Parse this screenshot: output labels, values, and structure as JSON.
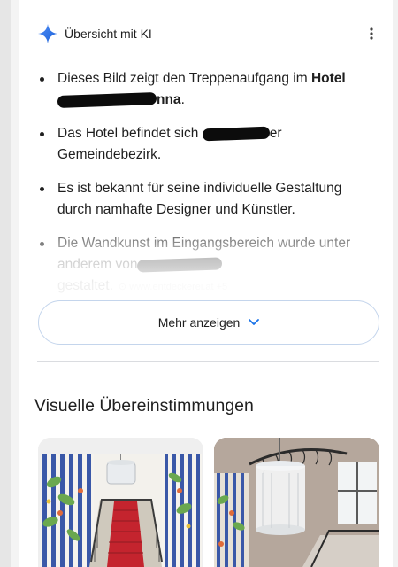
{
  "ai_overview": {
    "title": "Übersicht mit KI",
    "bullets": [
      {
        "before": "Dieses Bild zeigt den Treppenaufgang im ",
        "bold": "Hotel",
        "bold_tail": "nna",
        "after": "."
      },
      {
        "before": "Das Hotel befindet sich ",
        "tail": "er",
        "line2": "Gemeindebezirk."
      },
      {
        "text": "Es ist bekannt für seine individuelle Gestaltung durch namhafte Designer und Künstler."
      },
      {
        "before": "Die Wandkunst im Eingangsbereich wurde unter anderem von",
        "line2": "gestaltet.",
        "citation": "www.entdeckerei.at +5"
      }
    ],
    "more_button_label": "Mehr anzeigen"
  },
  "visual_matches": {
    "title": "Visuelle Übereinstimmungen"
  },
  "colors": {
    "accent_blue": "#1a73e8",
    "pill_border": "#c4d5ec",
    "carpet_red": "#c4242e"
  }
}
